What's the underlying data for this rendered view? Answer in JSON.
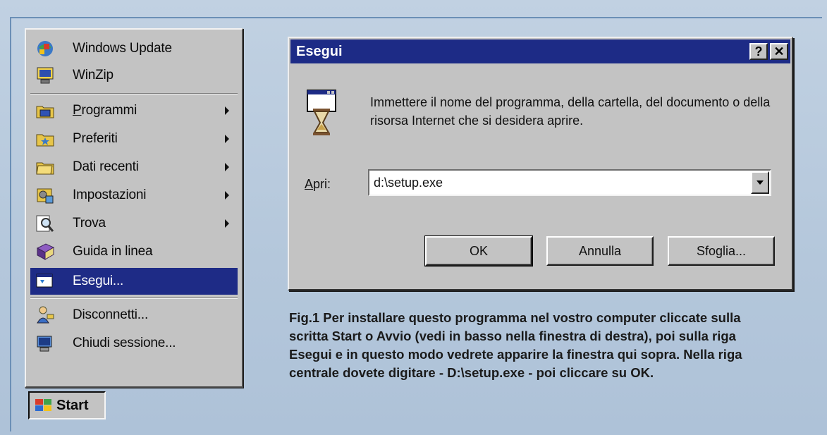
{
  "start_menu": {
    "items": [
      {
        "label": "Windows Update",
        "icon": "windows-update-icon",
        "submenu": false
      },
      {
        "label": "WinZip",
        "icon": "winzip-icon",
        "submenu": false
      },
      {
        "label": "Programmi",
        "icon": "programs-folder-icon",
        "submenu": true
      },
      {
        "label": "Preferiti",
        "icon": "favorites-folder-icon",
        "submenu": true
      },
      {
        "label": "Dati recenti",
        "icon": "documents-folder-icon",
        "submenu": true
      },
      {
        "label": "Impostazioni",
        "icon": "settings-icon",
        "submenu": true
      },
      {
        "label": "Trova",
        "icon": "find-icon",
        "submenu": true
      },
      {
        "label": "Guida in linea",
        "icon": "help-book-icon",
        "submenu": false
      },
      {
        "label": "Esegui...",
        "icon": "run-icon",
        "submenu": false,
        "selected": true
      },
      {
        "label": "Disconnetti...",
        "icon": "logoff-icon",
        "submenu": false
      },
      {
        "label": "Chiudi sessione...",
        "icon": "shutdown-icon",
        "submenu": false
      }
    ],
    "start_label": "Start"
  },
  "dialog": {
    "title": "Esegui",
    "help_button": "?",
    "close_button": "✕",
    "message": "Immettere il nome del programma, della cartella, del documento o della risorsa Internet che si desidera aprire.",
    "open_label": "Apri:",
    "open_value": "d:\\setup.exe",
    "ok_label": "OK",
    "cancel_label": "Annulla",
    "browse_label": "Sfoglia..."
  },
  "caption": "Fig.1 Per installare questo programma nel vostro computer cliccate sulla scritta Start o Avvio (vedi in basso nella finestra di destra), poi sulla riga Esegui e in questo modo vedrete apparire la finestra qui sopra. Nella riga centrale dovete digitare - D:\\setup.exe - poi cliccare su OK.",
  "colors": {
    "titlebar": "#1d2b86",
    "selection": "#1e2b86",
    "window_face": "#c3c3c3",
    "page_background": "#b7c9dc"
  }
}
